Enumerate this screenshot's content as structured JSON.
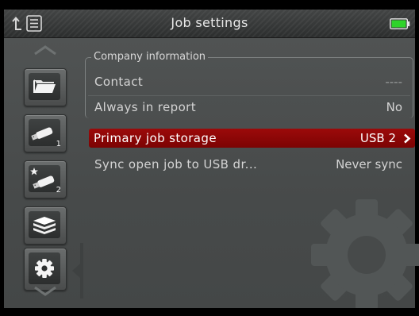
{
  "header": {
    "title": "Job settings"
  },
  "sidebar": {
    "tabs": [
      {
        "icon": "folder-icon"
      },
      {
        "icon": "usb-drive-icon",
        "number": "1"
      },
      {
        "icon": "usb-drive-starred-icon",
        "number": "2"
      },
      {
        "icon": "stack-icon"
      },
      {
        "icon": "gear-icon",
        "selected": true
      }
    ]
  },
  "company_group": {
    "legend": "Company information",
    "rows": [
      {
        "label": "Contact",
        "value": "----"
      },
      {
        "label": "Always in report",
        "value": "No"
      }
    ]
  },
  "settings": {
    "rows": [
      {
        "label": "Primary job storage",
        "value": "USB 2",
        "selected": true
      },
      {
        "label": "Sync open job to USB dr...",
        "value": "Never sync"
      }
    ]
  },
  "colors": {
    "selected_row": "#8c0606",
    "battery": "#2fd32a"
  }
}
